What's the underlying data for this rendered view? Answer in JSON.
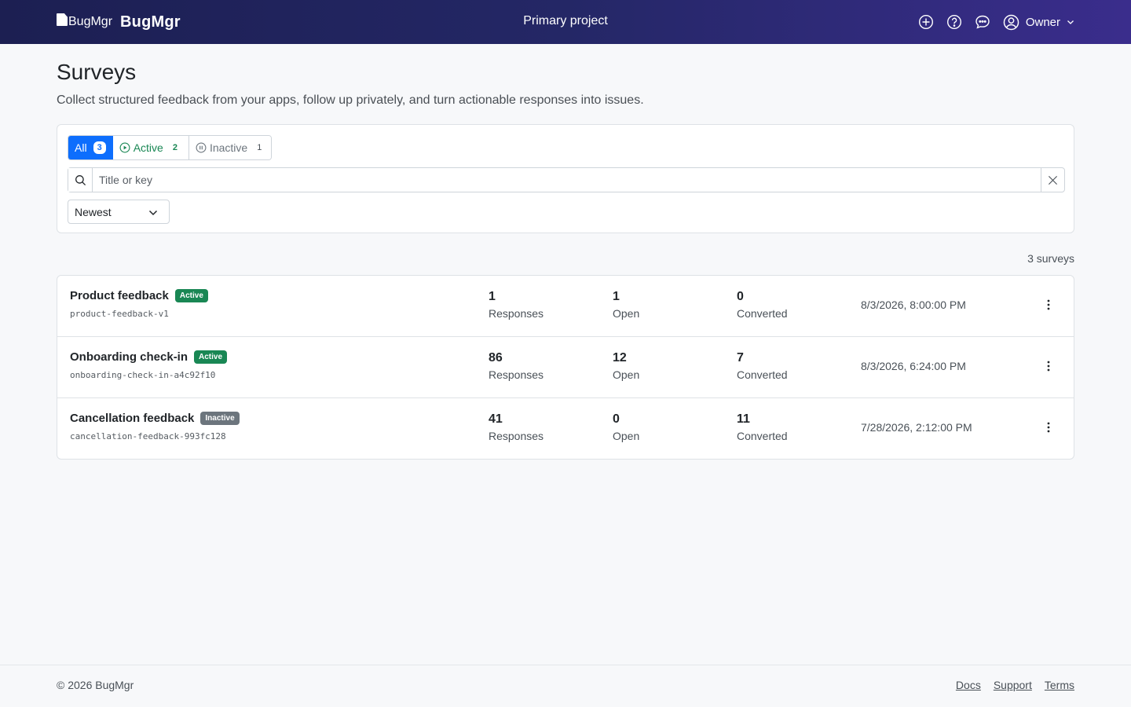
{
  "header": {
    "logo_alt": "BugMgr",
    "brand": "BugMgr",
    "project": "Primary project",
    "user": "Owner",
    "icons": [
      "plus-circle-icon",
      "question-circle-icon",
      "chat-icon",
      "user-circle-icon",
      "chevron-down-icon"
    ]
  },
  "page": {
    "title": "Surveys",
    "subtitle": "Collect structured feedback from your apps, follow up privately, and turn actionable responses into issues."
  },
  "filters": {
    "all_label": "All",
    "all_count": "3",
    "active_label": "Active",
    "active_count": "2",
    "inactive_label": "Inactive",
    "inactive_count": "1",
    "search_placeholder": "Title or key",
    "search_value": "",
    "sort_value": "Newest"
  },
  "summary": {
    "count_label": "3 surveys"
  },
  "surveys": [
    {
      "name": "Product feedback",
      "status": "Active",
      "key": "product-feedback-v1",
      "responses": "1",
      "open": "1",
      "converted": "0",
      "date": "8/3/2026, 8:00:00 PM"
    },
    {
      "name": "Onboarding check-in",
      "status": "Active",
      "key": "onboarding-check-in-a4c92f10",
      "responses": "86",
      "open": "12",
      "converted": "7",
      "date": "8/3/2026, 6:24:00 PM"
    },
    {
      "name": "Cancellation feedback",
      "status": "Inactive",
      "key": "cancellation-feedback-993fc128",
      "responses": "41",
      "open": "0",
      "converted": "11",
      "date": "7/28/2026, 2:12:00 PM"
    }
  ],
  "labels": {
    "responses": "Responses",
    "open": "Open",
    "converted": "Converted"
  },
  "footer": {
    "copyright": "© 2026 BugMgr",
    "links": [
      "Docs",
      "Support",
      "Terms"
    ]
  },
  "colors": {
    "accent": "#0d6efd",
    "success": "#198754",
    "muted": "#6c757d",
    "header_start": "#1c1f52",
    "header_end": "#3a2d8c"
  }
}
